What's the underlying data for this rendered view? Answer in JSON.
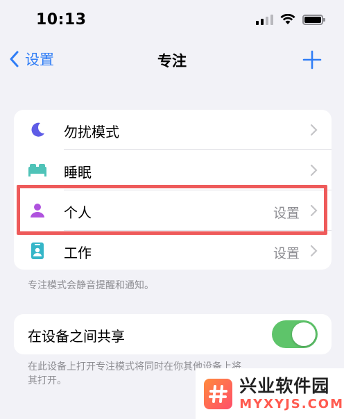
{
  "status": {
    "time": "10:13"
  },
  "nav": {
    "back_label": "设置",
    "title": "专注"
  },
  "focus_modes": [
    {
      "label": "勿扰模式",
      "value": "",
      "icon": "moon-icon",
      "color": "#5e5ce6"
    },
    {
      "label": "睡眠",
      "value": "",
      "icon": "bed-icon",
      "color": "#4fc3b8"
    },
    {
      "label": "个人",
      "value": "设置",
      "icon": "person-icon",
      "color": "#af52de"
    },
    {
      "label": "工作",
      "value": "设置",
      "icon": "id-badge-icon",
      "color": "#35b6c8"
    }
  ],
  "focus_footer": "专注模式会静音提醒和通知。",
  "share": {
    "label": "在设备之间共享",
    "enabled": true,
    "note_line1": "在此设备上打开专注模式将同时在你其他设备上将",
    "note_line2": "其打开。"
  },
  "watermark": {
    "cn": "兴业软件园",
    "en": "MYXYJS.COM"
  },
  "colors": {
    "accent": "#2f7df6",
    "toggle_on": "#5ec46a",
    "highlight": "#ee5a5a"
  }
}
